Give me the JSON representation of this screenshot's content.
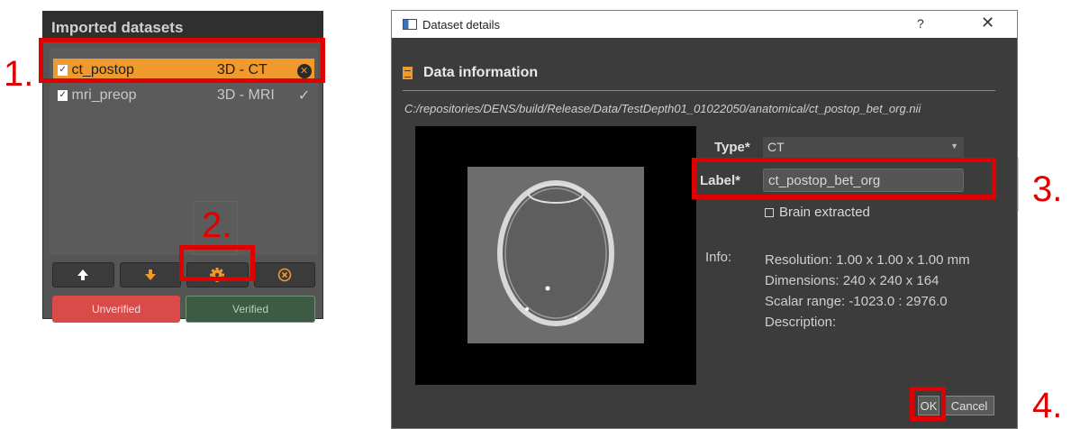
{
  "panel": {
    "title": "Imported datasets",
    "datasets": [
      {
        "name": "ct_postop",
        "type": "3D - CT",
        "selected": true,
        "checked": true
      },
      {
        "name": "mri_preop",
        "type": "3D - MRI",
        "selected": false,
        "checked": true,
        "status": "✓"
      }
    ],
    "tool_icons": [
      "arrow-up-icon",
      "arrow-down-icon",
      "gear-icon",
      "remove-circle-icon"
    ],
    "unverified_label": "Unverified",
    "verified_label": "Verified"
  },
  "steps": [
    "1.",
    "2.",
    "3.",
    "4."
  ],
  "dialog": {
    "title": "Dataset details",
    "help_glyph": "?",
    "close_glyph": "✕",
    "section_title": "Data information",
    "path": "C:/repositories/DENS/build/Release/Data/TestDepth01_01022050/anatomical/ct_postop_bet_org.nii",
    "type_label": "Type*",
    "type_value": "CT",
    "label_label": "Label*",
    "label_value": "ct_postop_bet_org",
    "brain_extracted_label": "Brain extracted",
    "info_label": "Info:",
    "info": {
      "resolution": "Resolution: 1.00 x 1.00 x 1.00 mm",
      "dimensions": "Dimensions: 240 x 240 x 164",
      "scalar_range": "Scalar range: -1023.0 : 2976.0",
      "description": "Description:"
    },
    "ok_label": "OK",
    "cancel_label": "Cancel"
  },
  "colors": {
    "accent": "#f0992d",
    "highlight": "#e00000",
    "unverified": "#d94a48",
    "verified": "#3d5a42"
  }
}
